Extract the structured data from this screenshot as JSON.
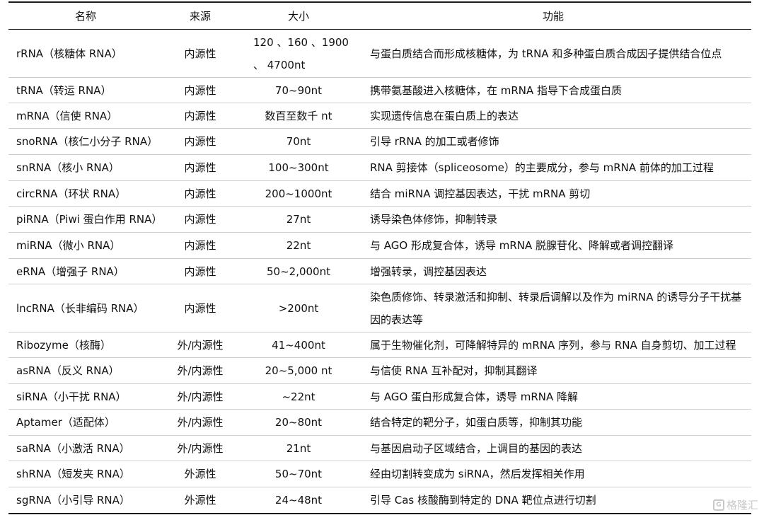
{
  "header": {
    "name": "名称",
    "source": "来源",
    "size": "大小",
    "function": "功能"
  },
  "rows": [
    {
      "name": "rRNA（核糖体 RNA）",
      "source": "内源性",
      "size": "120 、160 、1900 、 4700nt",
      "function": "与蛋白质结合而形成核糖体，为 tRNA 和多种蛋白质合成因子提供结合位点"
    },
    {
      "name": "tRNA（转运 RNA）",
      "source": "内源性",
      "size": "70~90nt",
      "function": "携带氨基酸进入核糖体，在 mRNA 指导下合成蛋白质"
    },
    {
      "name": "mRNA（信使 RNA）",
      "source": "内源性",
      "size": "数百至数千 nt",
      "function": "实现遗传信息在蛋白质上的表达"
    },
    {
      "name": "snoRNA（核仁小分子 RNA）",
      "source": "内源性",
      "size": "70nt",
      "function": "引导 rRNA 的加工或者修饰"
    },
    {
      "name": "snRNA（核小 RNA）",
      "source": "内源性",
      "size": "100~300nt",
      "function": "RNA 剪接体（spliceosome）的主要成分，参与 mRNA 前体的加工过程"
    },
    {
      "name": "circRNA（环状 RNA）",
      "source": "内源性",
      "size": "200~1000nt",
      "function": "结合 miRNA 调控基因表达，干扰 mRNA 剪切"
    },
    {
      "name": "piRNA（Piwi 蛋白作用 RNA）",
      "source": "内源性",
      "size": "27nt",
      "function": "诱导染色体修饰，抑制转录"
    },
    {
      "name": "miRNA（微小 RNA）",
      "source": "内源性",
      "size": "22nt",
      "function": "与 AGO 形成复合体，诱导 mRNA 脱腺苷化、降解或者调控翻译"
    },
    {
      "name": "eRNA（增强子 RNA）",
      "source": "内源性",
      "size": "50~2,000nt",
      "function": "增强转录，调控基因表达"
    },
    {
      "name": "lncRNA（长非编码 RNA）",
      "source": "内源性",
      "size": ">200nt",
      "function": "染色质修饰、转录激活和抑制、转录后调解以及作为 miRNA 的诱导分子干扰基因的表达等"
    },
    {
      "name": "Ribozyme（核酶）",
      "source": "外/内源性",
      "size": "41~400nt",
      "function": "属于生物催化剂，可降解特异的 mRNA 序列，参与 RNA 自身剪切、加工过程"
    },
    {
      "name": "asRNA（反义 RNA）",
      "source": "外/内源性",
      "size": "20~5,000 nt",
      "function": "与信使 RNA 互补配对，抑制其翻译"
    },
    {
      "name": "siRNA（小干扰 RNA）",
      "source": "外/内源性",
      "size": "~22nt",
      "function": "与 AGO 蛋白形成复合体，诱导 mRNA 降解"
    },
    {
      "name": "Aptamer（适配体）",
      "source": "外/内源性",
      "size": "20~80nt",
      "function": "结合特定的靶分子，如蛋白质等，抑制其功能"
    },
    {
      "name": "saRNA（小激活 RNA）",
      "source": "外/内源性",
      "size": "21nt",
      "function": "与基因启动子区域结合，上调目的基因的表达"
    },
    {
      "name": "shRNA（短发夹 RNA）",
      "source": "外源性",
      "size": "50~70nt",
      "function": "经由切割转变成为 siRNA，然后发挥相关作用"
    },
    {
      "name": "sgRNA（小引导 RNA）",
      "source": "外源性",
      "size": "24~48nt",
      "function": "引导 Cas 核酸酶到特定的 DNA 靶位点进行切割"
    }
  ],
  "watermark": {
    "text": "格隆汇",
    "mark": "G"
  }
}
